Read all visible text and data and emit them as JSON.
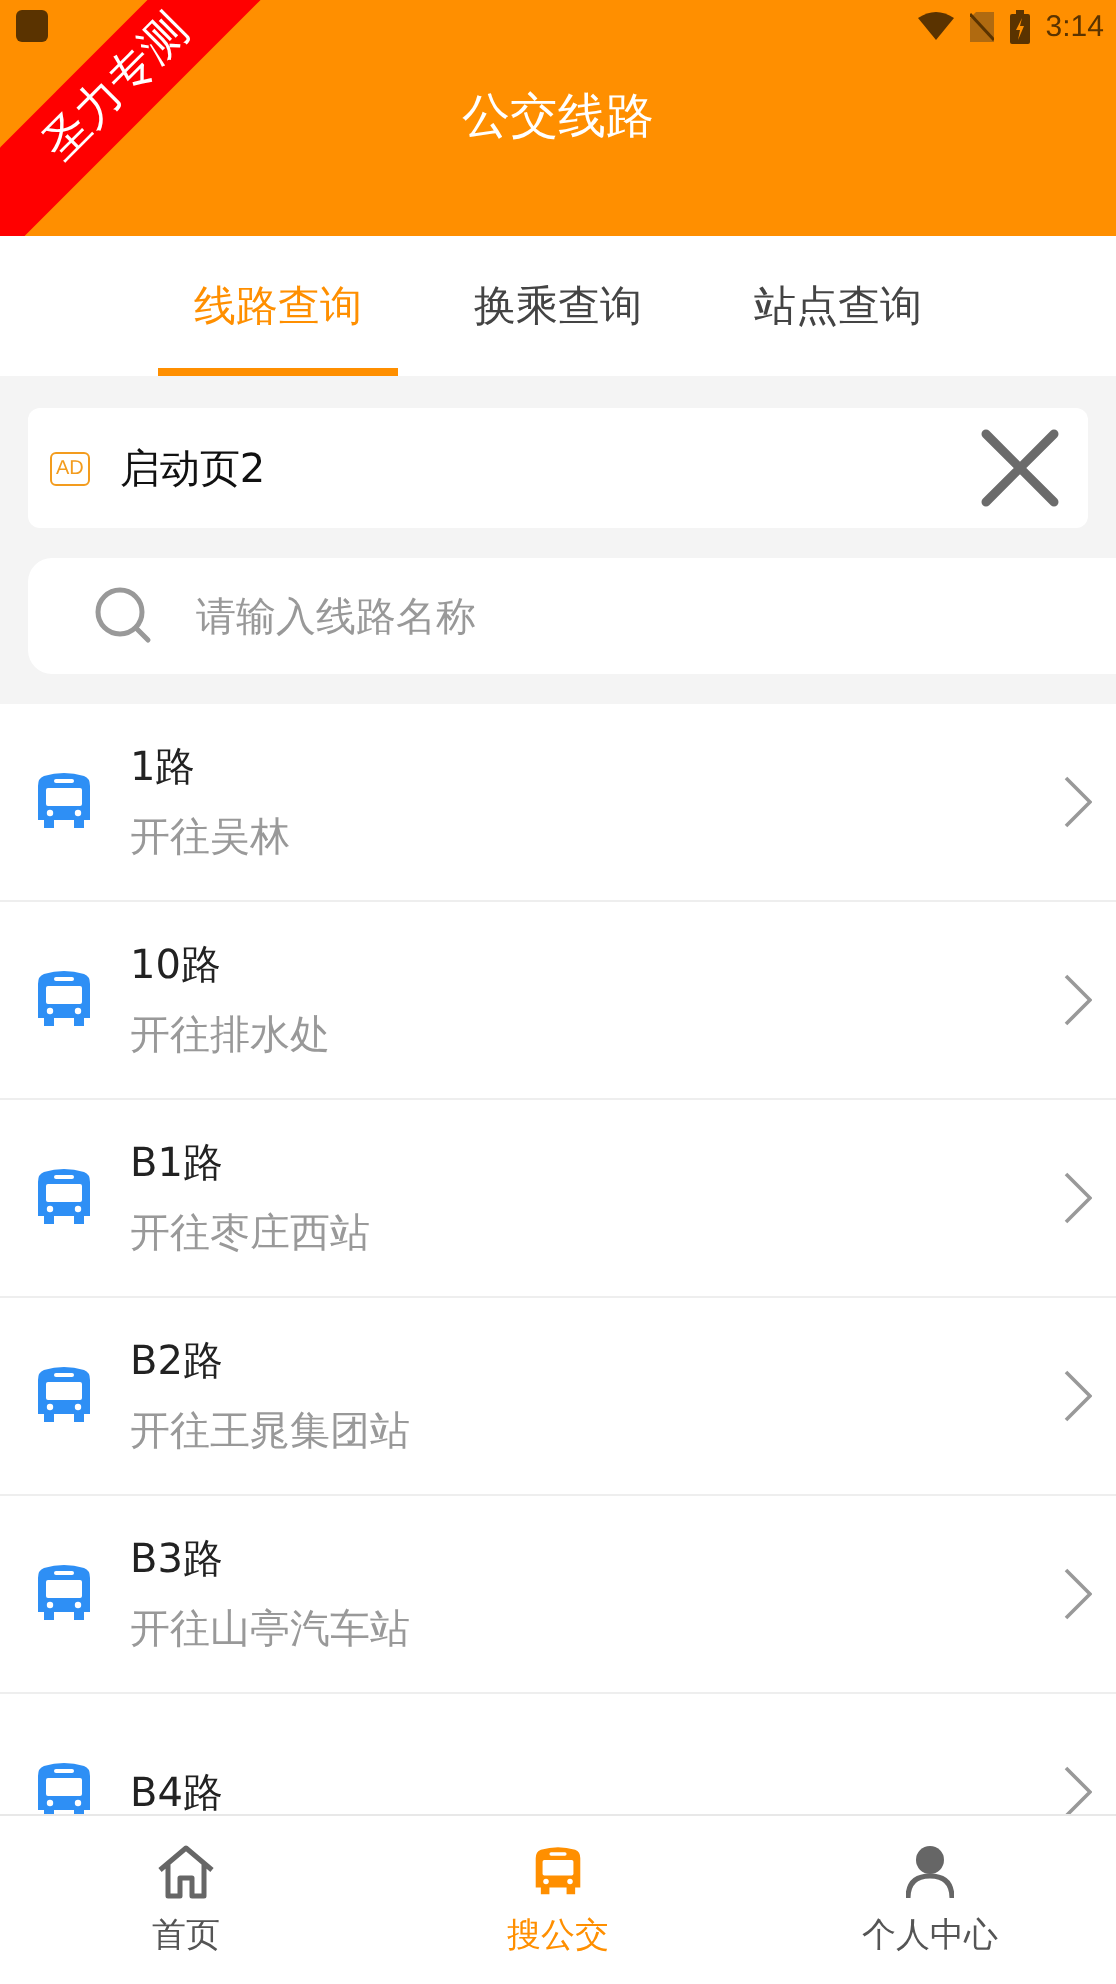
{
  "status_bar": {
    "time": "3:14"
  },
  "corner_ribbon": "圣力专测",
  "header": {
    "title": "公交线路"
  },
  "tabs": [
    {
      "label": "线路查询",
      "selected": true
    },
    {
      "label": "换乘查询",
      "selected": false
    },
    {
      "label": "站点查询",
      "selected": false
    }
  ],
  "ad": {
    "badge": "AD",
    "text": "启动页2"
  },
  "search": {
    "placeholder": "请输入线路名称"
  },
  "routes": [
    {
      "name": "1路",
      "direction": "开往吴林"
    },
    {
      "name": "10路",
      "direction": "开往排水处"
    },
    {
      "name": "B1路",
      "direction": "开往枣庄西站"
    },
    {
      "name": "B2路",
      "direction": "开往王晁集团站"
    },
    {
      "name": "B3路",
      "direction": "开往山亭汽车站"
    },
    {
      "name": "B4路"
    }
  ],
  "nav": [
    {
      "label": "首页",
      "kind": "home",
      "selected": false
    },
    {
      "label": "搜公交",
      "kind": "bus",
      "selected": true
    },
    {
      "label": "个人中心",
      "kind": "person",
      "selected": false
    }
  ]
}
